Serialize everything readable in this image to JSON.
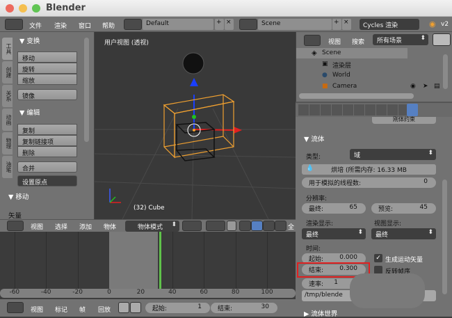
{
  "window": {
    "title": "Blender"
  },
  "topbar": {
    "menus": [
      "文件",
      "渲染",
      "窗口",
      "帮助"
    ],
    "layout": "Default",
    "scene": "Scene",
    "engine": "Cycles 渲染",
    "version": "v2"
  },
  "toolshelf": {
    "tabs": [
      "工具",
      "创建",
      "关系",
      "动画",
      "物理",
      "油笔"
    ],
    "transform": {
      "title": "▼ 变换",
      "buttons": [
        "移动",
        "旋转",
        "缩放"
      ],
      "mirror": "镜像"
    },
    "edit": {
      "title": "▼ 编辑",
      "buttons": [
        "复制",
        "复制链接项",
        "删除"
      ],
      "join": "合并",
      "origin": "设置原点"
    },
    "move": {
      "title": "▼ 移动",
      "vector": "矢量"
    }
  },
  "viewport": {
    "view_name": "用户视图 (透视)",
    "object_label": "(32) Cube"
  },
  "header3d": {
    "menus": [
      "视图",
      "选择",
      "添加",
      "物体"
    ],
    "mode": "物体模式",
    "global": "全"
  },
  "timeline": {
    "ticks": [
      "-60",
      "-40",
      "-20",
      "0",
      "20",
      "40",
      "60",
      "80",
      "100"
    ],
    "current_frame": 32,
    "range_start": 0,
    "range_end": 30,
    "menus": [
      "视图",
      "标记",
      "帧",
      "回放"
    ],
    "start_label": "起始:",
    "start": "1",
    "end_label": "结束:",
    "end": "30"
  },
  "outliner": {
    "menus": [
      "视图",
      "搜索"
    ],
    "filter": "所有场景",
    "items": [
      "Scene",
      "渲染层",
      "World",
      "Camera"
    ]
  },
  "properties": {
    "constraint_btn": "刚体约束",
    "panel": "▼ 流体",
    "type_label": "类型:",
    "type": "域",
    "bake": "烘培 (所需内存: 16.33 MB",
    "threads_label": "用于模拟的线程数:",
    "threads": "0",
    "resolution_label": "分辨率:",
    "final_label": "最终:",
    "final": "65",
    "preview_label": "预览:",
    "preview": "45",
    "render_display_label": "渲染显示:",
    "render_display": "最终",
    "view_display_label": "视图显示:",
    "view_display": "最终",
    "time_label": "时间:",
    "start_label": "起始:",
    "start": "0.000",
    "end_label": "结束:",
    "end": "0.300",
    "speed_label": "速率:",
    "speed": "1",
    "motion_vectors": "生成运动矢量",
    "reverse_frames": "反转帧序",
    "path": "/tmp/blende",
    "fluid_world": "▶ 流体世界"
  },
  "colors": {
    "highlight": "#e02020",
    "frame_marker": "#5fc24a",
    "selected_object": "#f0a030"
  }
}
